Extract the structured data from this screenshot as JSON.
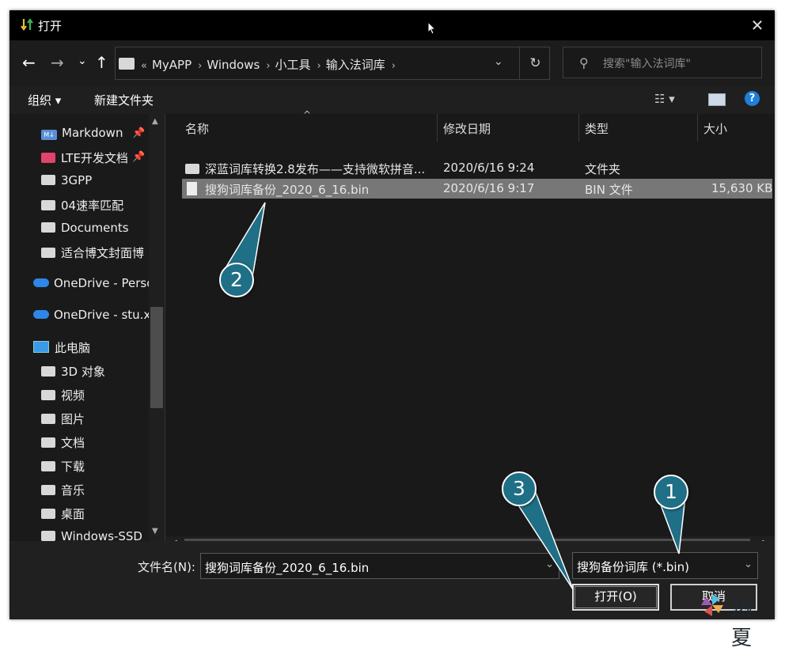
{
  "window": {
    "title": "打开",
    "close_glyph": "✕"
  },
  "nav_buttons": {
    "back": "←",
    "forward": "→",
    "recent": "⌄",
    "up": "↑"
  },
  "address": {
    "overflow": "«",
    "crumbs": [
      "MyAPP",
      "Windows",
      "小工具",
      "输入法词库"
    ],
    "separator": "›"
  },
  "search": {
    "placeholder": "搜索\"输入法词库\""
  },
  "toolbar": {
    "organize": "组织 ▾",
    "new_folder": "新建文件夹",
    "view": "☷ ▾"
  },
  "sidebar": {
    "quick": [
      {
        "label": "Markdown",
        "icon": "markdown-icon",
        "pinned": true
      },
      {
        "label": "LTE开发文档",
        "icon": "folder-pink-icon",
        "pinned": true
      },
      {
        "label": "3GPP",
        "icon": "folder-icon"
      },
      {
        "label": "04速率匹配",
        "icon": "folder-icon"
      },
      {
        "label": "Documents",
        "icon": "folder-icon"
      },
      {
        "label": "适合博文封面博",
        "icon": "folder-icon"
      }
    ],
    "onedrive1": "OneDrive - Perso",
    "onedrive2": "OneDrive - stu.x",
    "this_pc": "此电脑",
    "pc_items": [
      "3D 对象",
      "视频",
      "图片",
      "文档",
      "下载",
      "音乐",
      "桌面",
      "Windows-SSD"
    ]
  },
  "columns": {
    "name": "名称",
    "modified": "修改日期",
    "type": "类型",
    "size": "大小"
  },
  "files": [
    {
      "name": "深蓝词库转换2.8发布——支持微软拼音...",
      "modified": "2020/6/16 9:24",
      "type": "文件夹",
      "size": "",
      "kind": "folder"
    },
    {
      "name": "搜狗词库备份_2020_6_16.bin",
      "modified": "2020/6/16 9:17",
      "type": "BIN 文件",
      "size": "15,630 KB",
      "kind": "file",
      "selected": true
    }
  ],
  "footer": {
    "filename_label": "文件名(N):",
    "filename_value": "搜狗词库备份_2020_6_16.bin",
    "filetype_value": "搜狗备份词库 (*.bin)",
    "open_button": "打开(O)",
    "cancel_button": "取消"
  },
  "callouts": [
    "1",
    "2",
    "3"
  ],
  "watermark": "热夏",
  "colors": {
    "callout": "#1f6f86",
    "selection": "#777777",
    "background": "#202020"
  }
}
